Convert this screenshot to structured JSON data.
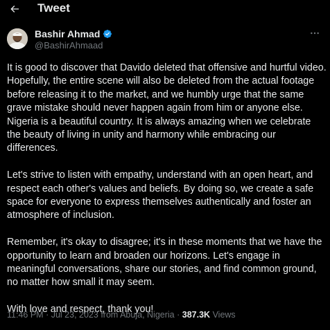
{
  "header": {
    "title": "Tweet"
  },
  "author": {
    "name": "Bashir Ahmad",
    "handle": "@BashirAhmaad",
    "verified_color": "#1d9bf0"
  },
  "tweet": {
    "paragraphs": [
      "It is good to discover that Davido deleted that offensive and hurtful video. Hopefully, the entire scene will also be deleted from the actual footage before releasing it to the market, and we humbly urge that the same grave mistake should never happen again from him or anyone else. Nigeria is a beautiful country. It is always amazing when we celebrate the beauty of living in unity and harmony while embracing our differences.",
      "Let's strive to listen with empathy, understand with an open heart, and respect each other's values and beliefs. By doing so, we create a safe space for everyone to express themselves authentically and foster an atmosphere of inclusion.",
      "Remember, it's okay to disagree; it's in these moments that we have the opportunity to learn and broaden our horizons. Let's engage in meaningful conversations, share our stories, and find common ground, no matter how small it may seem.",
      "With love and respect, thank you!"
    ]
  },
  "meta": {
    "time": "11:46 PM",
    "separator": "·",
    "date": "Jul 23, 2023",
    "location": "from Abuja, Nigeria",
    "views_count": "387.3K",
    "views_label": "Views"
  },
  "colors": {
    "background": "#000000",
    "text": "#e7e9ea",
    "secondary_text": "#71767b"
  }
}
